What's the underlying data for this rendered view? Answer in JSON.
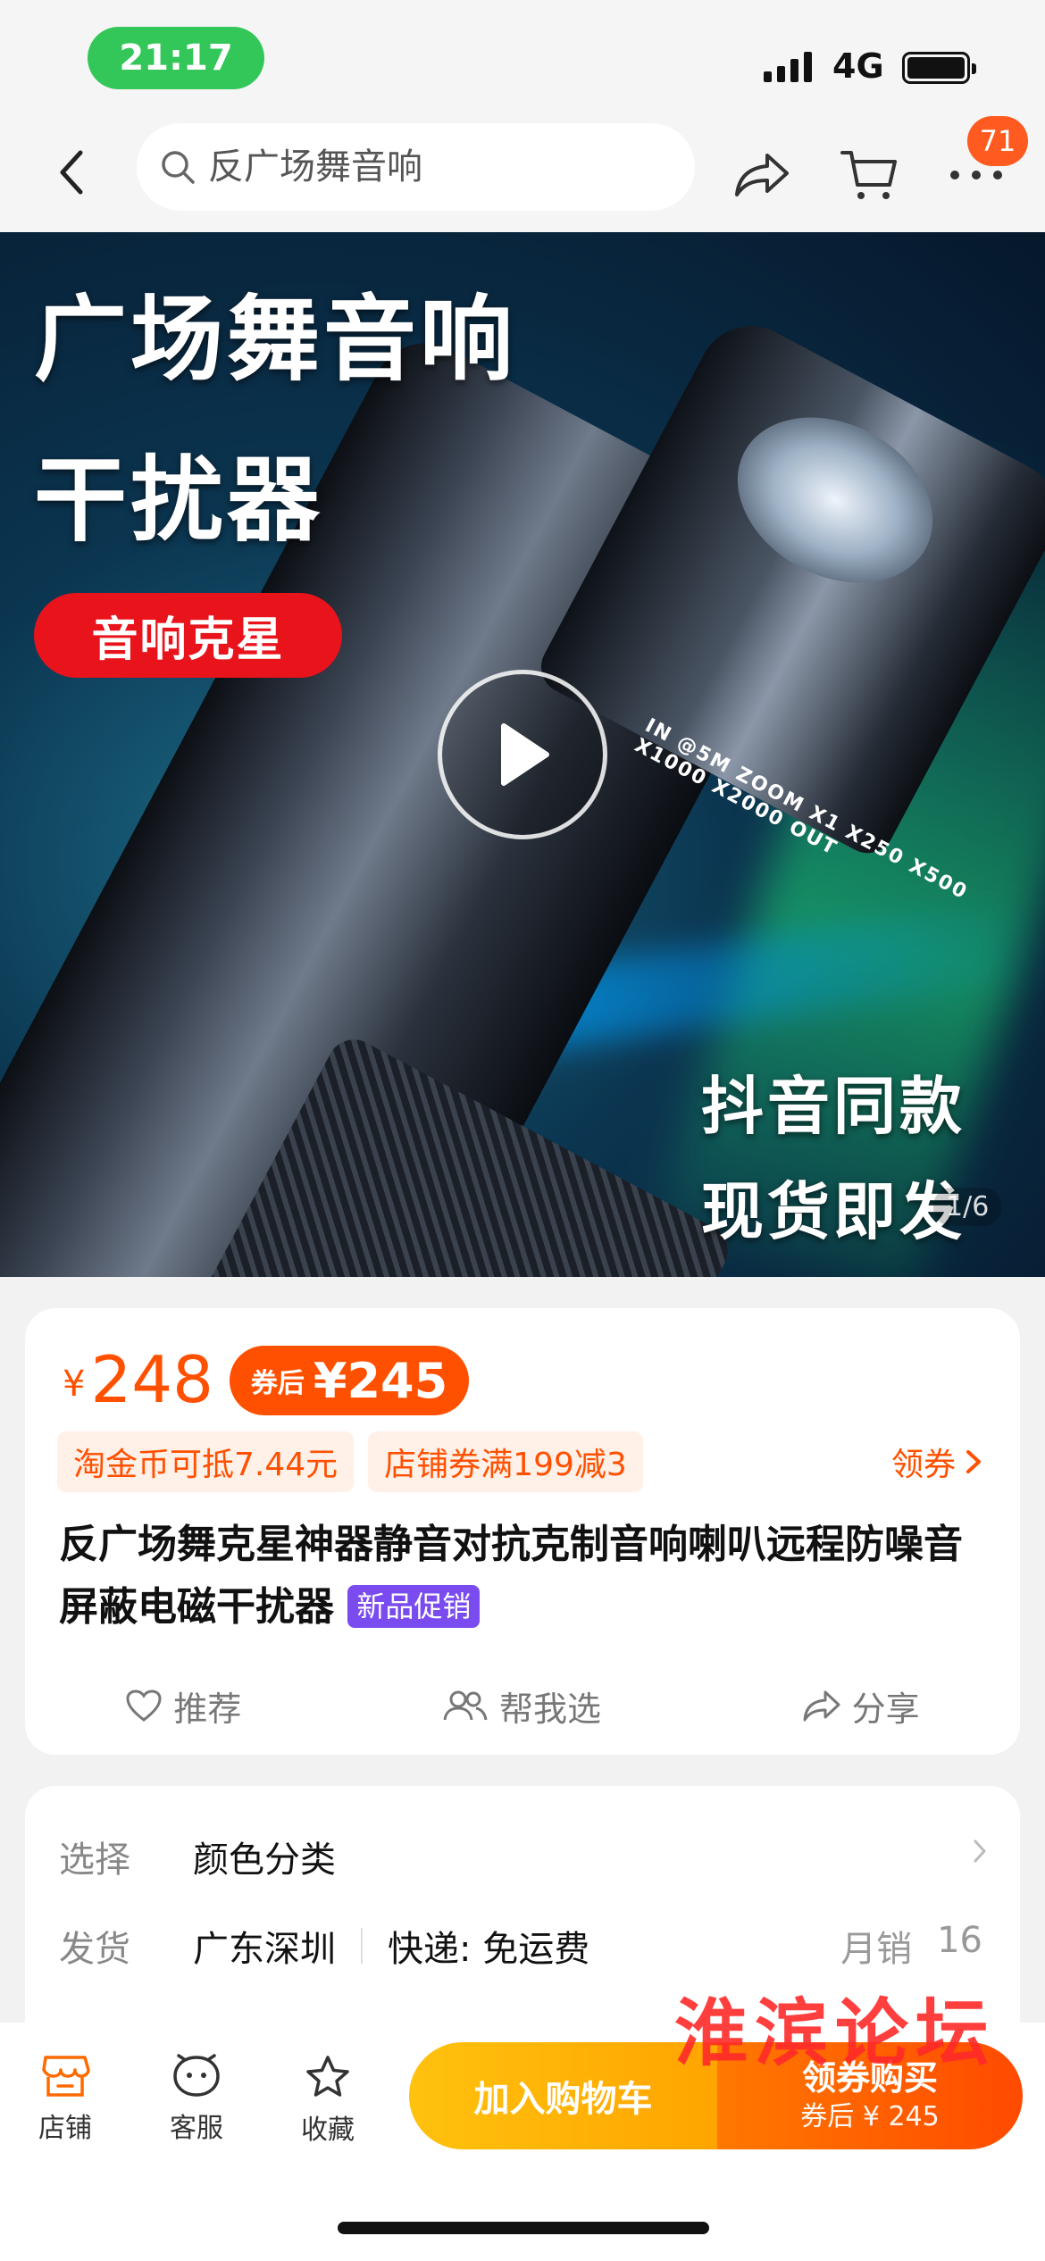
{
  "status_bar": {
    "time": "21:17",
    "network": "4G"
  },
  "nav": {
    "search_placeholder": "反广场舞音响",
    "badge_count": "71"
  },
  "hero": {
    "headline_line1": "广场舞音响",
    "headline_line2": "干扰器",
    "red_tag": "音响克星",
    "zoom_text": "IN  @5M  ZOOM  X1 X250 X500 X1000 X2000  OUT",
    "promo_line1": "抖音同款",
    "promo_line2": "现货即发",
    "page_indicator": "1/6"
  },
  "price": {
    "currency": "¥",
    "value": "248",
    "coupon_label": "券后",
    "coupon_value": "¥245",
    "tags": [
      "淘金币可抵7.44元",
      "店铺券满199减3"
    ],
    "get_coupon": "领券"
  },
  "product": {
    "title": "反广场舞克星神器静音对抗克制音响喇叭远程防噪音屏蔽电磁干扰器",
    "new_badge": "新品促销"
  },
  "actions": {
    "recommend": "推荐",
    "help_choose": "帮我选",
    "share": "分享"
  },
  "options": {
    "select_key": "选择",
    "select_value": "颜色分类",
    "ship_key": "发货",
    "ship_origin": "广东深圳",
    "ship_method": "快递: 免运费",
    "monthly_label": "月销",
    "monthly_value": "16"
  },
  "watermark": "淮滨论坛",
  "bottom": {
    "store": "店铺",
    "service": "客服",
    "favorite": "收藏",
    "add_cart": "加入购物车",
    "buy_main": "领券购买",
    "buy_sub": "券后 ¥ 245"
  },
  "colors": {
    "accent": "#ff5000",
    "status_green": "#33c759",
    "new_badge": "#7a4cf0"
  }
}
